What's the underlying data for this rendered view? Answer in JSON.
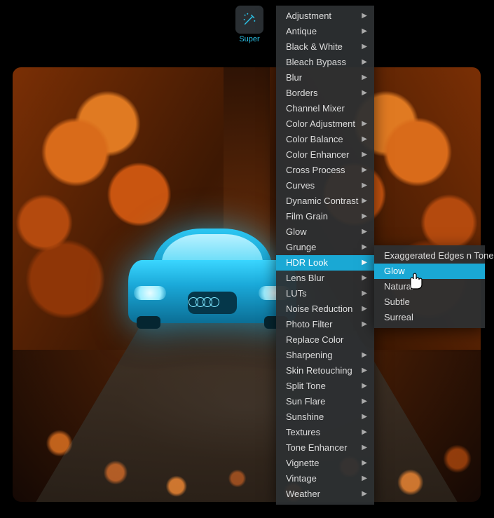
{
  "tool": {
    "name": "super-tool",
    "label": "Super",
    "icon": "magic-wand-icon",
    "accent": "#2bc3e8"
  },
  "menu": {
    "selected": "HDR Look",
    "items": [
      {
        "label": "Adjustment",
        "submenu": true
      },
      {
        "label": "Antique",
        "submenu": true
      },
      {
        "label": "Black & White",
        "submenu": true
      },
      {
        "label": "Bleach Bypass",
        "submenu": true
      },
      {
        "label": "Blur",
        "submenu": true
      },
      {
        "label": "Borders",
        "submenu": true
      },
      {
        "label": "Channel Mixer",
        "submenu": false
      },
      {
        "label": "Color Adjustment",
        "submenu": true
      },
      {
        "label": "Color Balance",
        "submenu": true
      },
      {
        "label": "Color Enhancer",
        "submenu": true
      },
      {
        "label": "Cross Process",
        "submenu": true
      },
      {
        "label": "Curves",
        "submenu": true
      },
      {
        "label": "Dynamic Contrast",
        "submenu": true
      },
      {
        "label": "Film Grain",
        "submenu": true
      },
      {
        "label": "Glow",
        "submenu": true
      },
      {
        "label": "Grunge",
        "submenu": true
      },
      {
        "label": "HDR Look",
        "submenu": true,
        "selected": true
      },
      {
        "label": "Lens Blur",
        "submenu": true
      },
      {
        "label": "LUTs",
        "submenu": true
      },
      {
        "label": "Noise Reduction",
        "submenu": true
      },
      {
        "label": "Photo Filter",
        "submenu": true
      },
      {
        "label": "Replace Color",
        "submenu": false
      },
      {
        "label": "Sharpening",
        "submenu": true
      },
      {
        "label": "Skin Retouching",
        "submenu": true
      },
      {
        "label": "Split Tone",
        "submenu": true
      },
      {
        "label": "Sun Flare",
        "submenu": true
      },
      {
        "label": "Sunshine",
        "submenu": true
      },
      {
        "label": "Textures",
        "submenu": true
      },
      {
        "label": "Tone Enhancer",
        "submenu": true
      },
      {
        "label": "Vignette",
        "submenu": true
      },
      {
        "label": "Vintage",
        "submenu": true
      },
      {
        "label": "Weather",
        "submenu": true
      }
    ]
  },
  "submenu": {
    "parent": "HDR Look",
    "selected": "Glow",
    "items": [
      {
        "label": "Exaggerated Edges n Tone"
      },
      {
        "label": "Glow",
        "selected": true
      },
      {
        "label": "Natural"
      },
      {
        "label": "Subtle"
      },
      {
        "label": "Surreal"
      }
    ]
  },
  "canvas": {
    "subject": "sports-car",
    "highlight_color": "#2bd4ff",
    "scene": "autumn-forest-road"
  }
}
